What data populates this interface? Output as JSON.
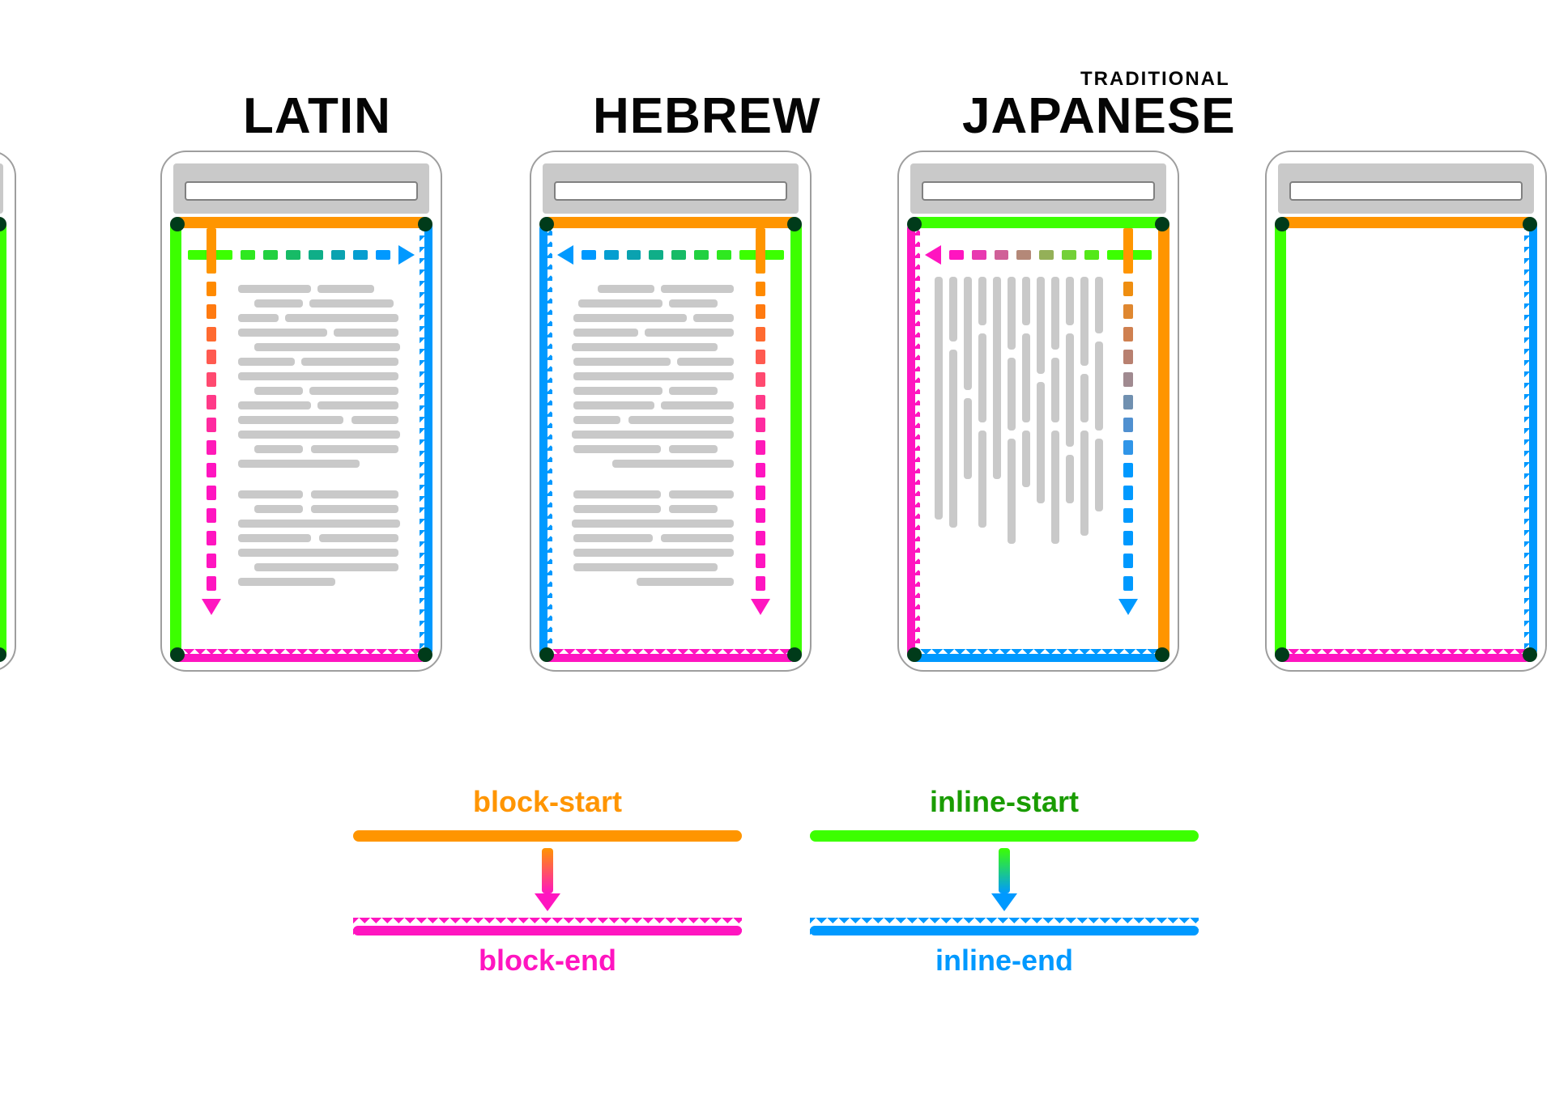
{
  "labels": {
    "latin": "LATIN",
    "hebrew": "HEBREW",
    "japanese": "JAPANESE",
    "traditional": "TRADITIONAL"
  },
  "legend": {
    "block_start": "block-start",
    "block_end": "block-end",
    "inline_start": "inline-start",
    "inline_end": "inline-end"
  },
  "colors": {
    "block_start": "#ff9500",
    "block_end": "#ff15c0",
    "inline_start": "#3cff00",
    "inline_end": "#0099ff"
  },
  "phones": {
    "latin": {
      "inline_dir": "ltr",
      "block_dir": "ttb",
      "top": "orange",
      "bottom": "magenta-zig",
      "left": "green",
      "right": "blue-zig",
      "inline_arrow_gradient": "green-to-blue",
      "block_arrow_gradient": "orange-to-magenta"
    },
    "hebrew": {
      "inline_dir": "rtl",
      "block_dir": "ttb",
      "top": "orange",
      "bottom": "magenta-zig",
      "left": "blue-zig",
      "right": "green",
      "inline_arrow_gradient": "green-to-blue",
      "block_arrow_gradient": "orange-to-magenta"
    },
    "japanese": {
      "inline_dir": "ttb",
      "block_dir": "rtl",
      "top": "green",
      "bottom": "blue-zig",
      "left": "magenta-zig",
      "right": "orange",
      "inline_arrow_gradient": "green-to-magenta",
      "block_arrow_gradient": "orange-to-blue"
    }
  }
}
